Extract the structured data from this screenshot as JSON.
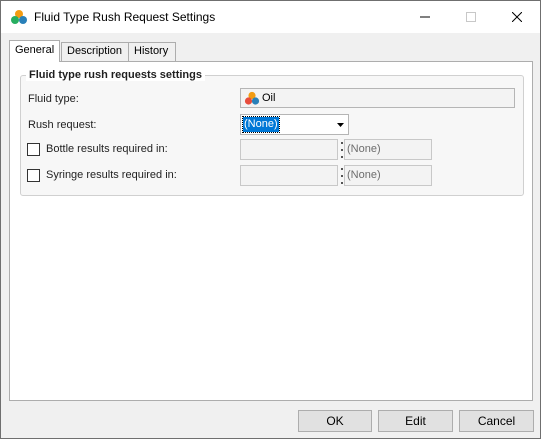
{
  "window": {
    "title": "Fluid Type Rush Request Settings",
    "icon": "fluid-type-icon"
  },
  "tabs": [
    {
      "label": "General",
      "active": true
    },
    {
      "label": "Description",
      "active": false
    },
    {
      "label": "History",
      "active": false
    }
  ],
  "group": {
    "title": "Fluid type rush requests settings"
  },
  "fields": {
    "fluid_type_label": "Fluid type:",
    "fluid_type_value": "Oil",
    "rush_request_label": "Rush request:",
    "rush_request_value": "(None)",
    "bottle_label": "Bottle results required in:",
    "bottle_checked": false,
    "bottle_unit": "(None)",
    "syringe_label": "Syringe results required in:",
    "syringe_checked": false,
    "syringe_unit": "(None)"
  },
  "buttons": {
    "ok": "OK",
    "edit": "Edit",
    "cancel": "Cancel"
  },
  "colors": {
    "selection": "#0078d7",
    "window_bg": "#f0f0f0"
  }
}
